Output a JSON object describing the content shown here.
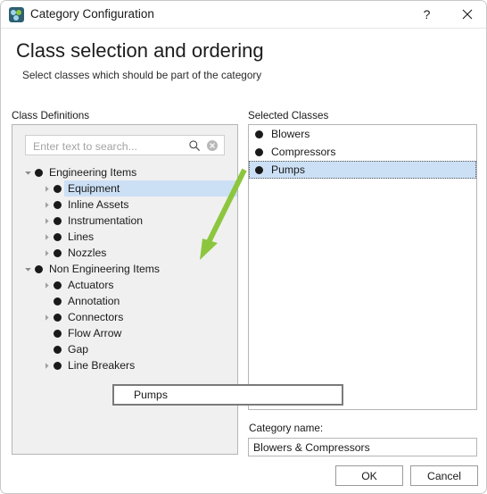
{
  "window": {
    "title": "Category Configuration",
    "icon": "app-category-icon",
    "help_label": "?",
    "close_label": "close-icon"
  },
  "header": {
    "title": "Class selection and ordering",
    "subtitle": "Select classes which should be part of the category"
  },
  "left": {
    "label": "Class Definitions",
    "search": {
      "placeholder": "Enter text to search...",
      "value": "",
      "search_icon": "search-icon",
      "clear_icon": "clear-icon"
    },
    "tree": [
      {
        "label": "Engineering Items",
        "depth": 0,
        "twisty": "expanded",
        "selected": false
      },
      {
        "label": "Equipment",
        "depth": 1,
        "twisty": "collapsed",
        "selected": true
      },
      {
        "label": "Inline Assets",
        "depth": 1,
        "twisty": "collapsed",
        "selected": false
      },
      {
        "label": "Instrumentation",
        "depth": 1,
        "twisty": "collapsed",
        "selected": false
      },
      {
        "label": "Lines",
        "depth": 1,
        "twisty": "collapsed",
        "selected": false
      },
      {
        "label": "Nozzles",
        "depth": 1,
        "twisty": "collapsed",
        "selected": false
      },
      {
        "label": "Non Engineering Items",
        "depth": 0,
        "twisty": "expanded",
        "selected": false
      },
      {
        "label": "Actuators",
        "depth": 1,
        "twisty": "collapsed",
        "selected": false
      },
      {
        "label": "Annotation",
        "depth": 1,
        "twisty": "none",
        "selected": false
      },
      {
        "label": "Connectors",
        "depth": 1,
        "twisty": "collapsed",
        "selected": false
      },
      {
        "label": "Flow Arrow",
        "depth": 1,
        "twisty": "none",
        "selected": false
      },
      {
        "label": "Gap",
        "depth": 1,
        "twisty": "none",
        "selected": false
      },
      {
        "label": "Line Breakers",
        "depth": 1,
        "twisty": "collapsed",
        "selected": false
      }
    ]
  },
  "right": {
    "label": "Selected Classes",
    "items": [
      {
        "label": "Blowers",
        "selected": false
      },
      {
        "label": "Compressors",
        "selected": false
      },
      {
        "label": "Pumps",
        "selected": true
      }
    ]
  },
  "drag_ghost": {
    "label": "Pumps"
  },
  "category": {
    "label": "Category name:",
    "value": "Blowers & Compressors",
    "placeholder": ""
  },
  "buttons": {
    "ok": "OK",
    "cancel": "Cancel"
  },
  "annotation": {
    "arrow_color": "#8cc63e",
    "description": "green-arrow-annotation"
  },
  "colors": {
    "selection": "#cce0f5",
    "panel_bg": "#f0f0f0",
    "border": "#b5b5b5",
    "accent_green": "#8cc63e",
    "icon_teal": "#2e5f72"
  }
}
